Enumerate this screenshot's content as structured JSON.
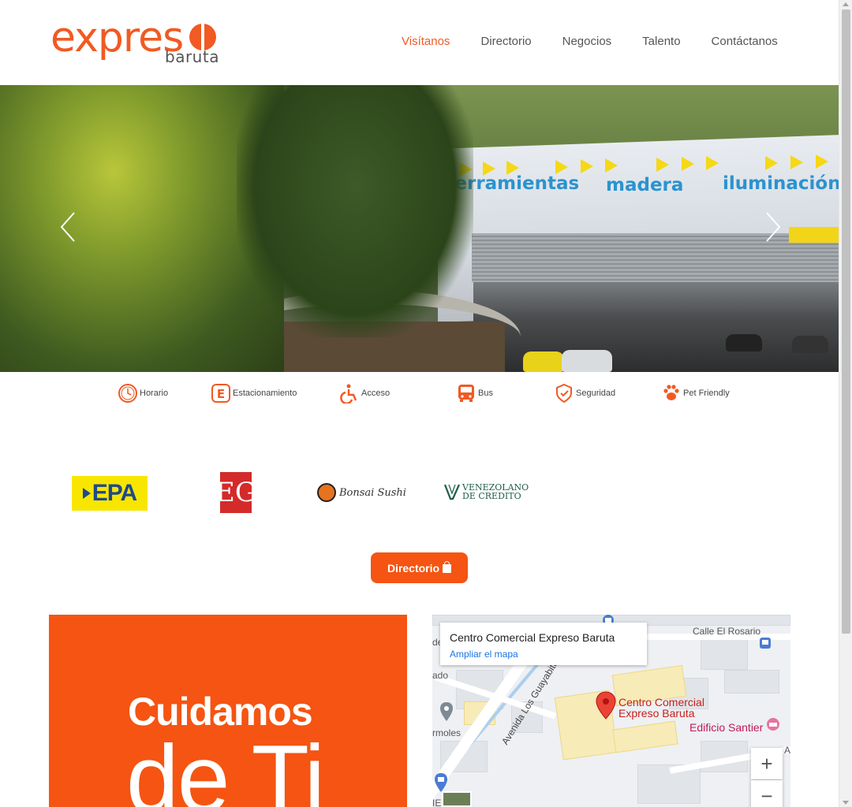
{
  "brand": {
    "word": "expres",
    "sub": "baruta"
  },
  "nav": [
    {
      "label": "Visítanos",
      "active": true
    },
    {
      "label": "Directorio",
      "active": false
    },
    {
      "label": "Negocios",
      "active": false
    },
    {
      "label": "Talento",
      "active": false
    },
    {
      "label": "Contáctanos",
      "active": false
    }
  ],
  "hero": {
    "signs": [
      "herramientas",
      "madera",
      "iluminación"
    ]
  },
  "amenities": [
    {
      "label": "Horario",
      "icon": "clock-icon"
    },
    {
      "label": "Estacionamiento",
      "icon": "parking-icon"
    },
    {
      "label": "Acceso",
      "icon": "wheelchair-icon"
    },
    {
      "label": "Bus",
      "icon": "bus-icon"
    },
    {
      "label": "Seguridad",
      "icon": "shield-icon"
    },
    {
      "label": "Pet Friendly",
      "icon": "paw-icon"
    }
  ],
  "brands": {
    "epa": "EPA",
    "eg": "EG",
    "bonsai": "Bonsai Sushi",
    "venezolano_line1": "VENEZOLANO",
    "venezolano_line2": "DE CREDITO"
  },
  "directory_button": "Directorio",
  "promo": {
    "line1": "Cuidamos",
    "line2": "de Ti"
  },
  "map": {
    "title": "Centro Comercial Expreso Baruta",
    "link": "Ampliar el mapa",
    "street1": "Calle El Rosario",
    "street2": "Avenida Los Guayabitos",
    "place_line1": "Centro Comercial",
    "place_line2": "Expreso Baruta",
    "place2": "Edificio Santier",
    "fragment1": "de",
    "fragment2": "ado",
    "fragment3": "rmoles",
    "fragment4": "IE",
    "fragment5": "A",
    "zoom_in": "+",
    "zoom_out": "−"
  },
  "colors": {
    "accent": "#f15a22",
    "button": "#f55412",
    "map_link": "#1a73e8"
  }
}
